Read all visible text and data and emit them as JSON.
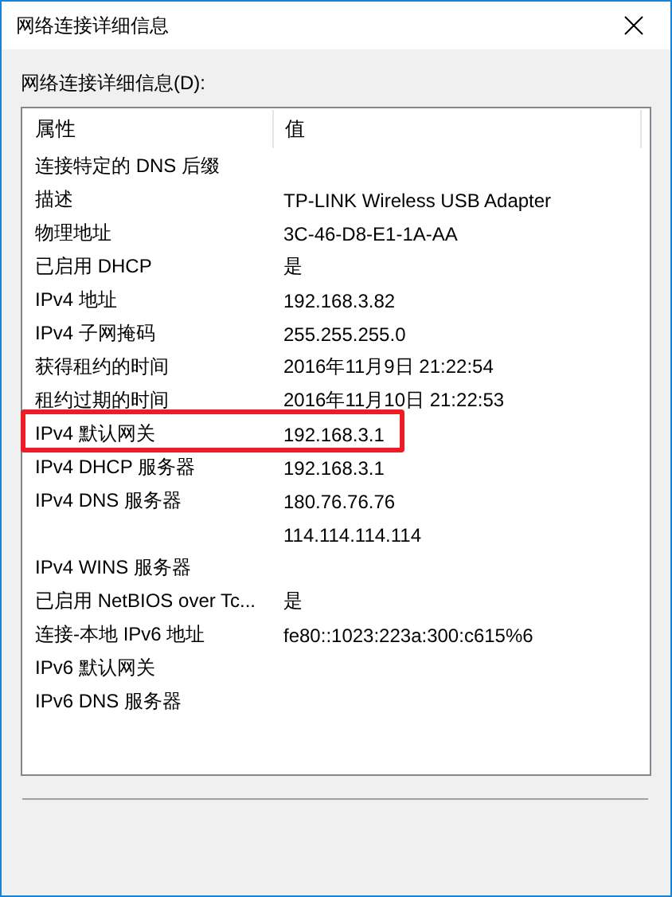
{
  "window": {
    "title": "网络连接详细信息"
  },
  "list_label": "网络连接详细信息(D):",
  "table": {
    "columns": [
      "属性",
      "值"
    ],
    "rows": [
      {
        "property": "连接特定的 DNS 后缀",
        "highlighted": false
      },
      {
        "property": "描述",
        "value": "TP-LINK Wireless USB Adapter",
        "highlighted": false
      },
      {
        "property": "物理地址",
        "value": "3C-46-D8-E1-1A-AA",
        "highlighted": false
      },
      {
        "property": "已启用 DHCP",
        "value": "是",
        "highlighted": false
      },
      {
        "property": "IPv4 地址",
        "value": "192.168.3.82",
        "highlighted": false
      },
      {
        "property": "IPv4 子网掩码",
        "value": "255.255.255.0",
        "highlighted": false
      },
      {
        "property": "获得租约的时间",
        "value": "2016年11月9日 21:22:54",
        "highlighted": false
      },
      {
        "property": "租约过期的时间",
        "value": "2016年11月10日 21:22:53",
        "highlighted": false
      },
      {
        "property": "IPv4 默认网关",
        "value": "192.168.3.1",
        "highlighted": true
      },
      {
        "property": "IPv4 DHCP 服务器",
        "value": "192.168.3.1",
        "highlighted": false
      },
      {
        "property": "IPv4 DNS 服务器",
        "value": "180.76.76.76",
        "highlighted": false
      },
      {
        "value": "114.114.114.114",
        "highlighted": false
      },
      {
        "property": "IPv4 WINS 服务器",
        "highlighted": false
      },
      {
        "property": "已启用 NetBIOS over Tc...",
        "value": "是",
        "highlighted": false
      },
      {
        "property": "连接-本地 IPv6 地址",
        "value": "fe80::1023:223a:300:c615%6",
        "highlighted": false
      },
      {
        "property": "IPv6 默认网关",
        "highlighted": false
      },
      {
        "property": "IPv6 DNS 服务器",
        "highlighted": false
      }
    ]
  }
}
